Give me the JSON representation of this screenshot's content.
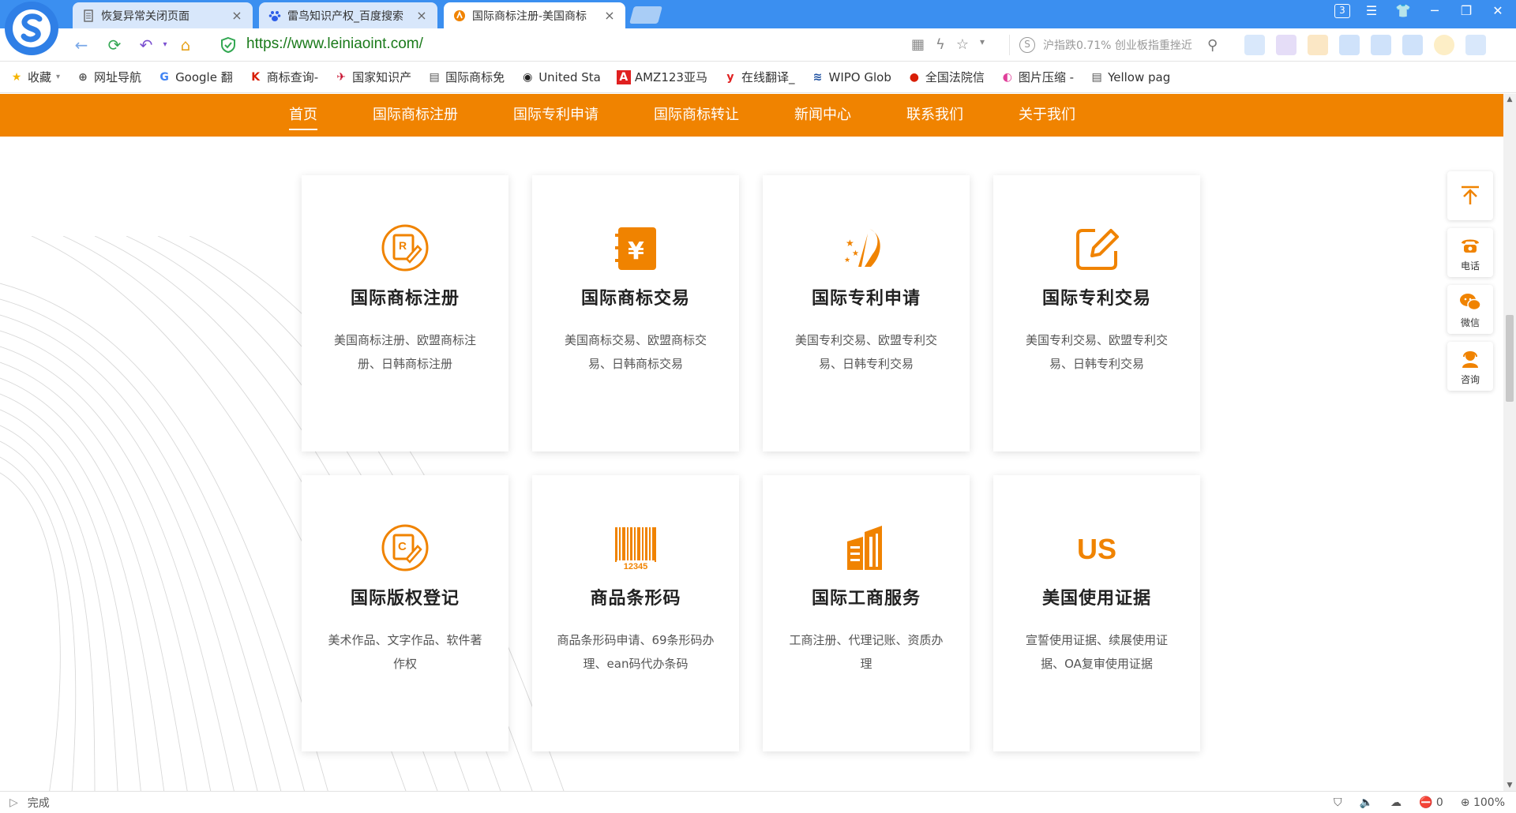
{
  "browser": {
    "tabs": [
      {
        "title": "恢复异常关闭页面",
        "icon": "page-icon"
      },
      {
        "title": "雷鸟知识产权_百度搜索",
        "icon": "baidu-paw-icon"
      },
      {
        "title": "国际商标注册-美国商标",
        "icon": "site-favicon-icon"
      }
    ],
    "window_badge": "3",
    "url": "https://www.leiniaoint.com/",
    "search_placeholder": "沪指跌0.71% 创业板指重挫近",
    "bookmarks": [
      {
        "label": "收藏",
        "icon": "star-icon"
      },
      {
        "label": "网址导航",
        "icon": "globe-icon"
      },
      {
        "label": "Google 翻",
        "icon": "google-translate-icon"
      },
      {
        "label": "商标查询-",
        "icon": "k-icon"
      },
      {
        "label": "国家知识产",
        "icon": "cnipa-icon"
      },
      {
        "label": "国际商标免",
        "icon": "page-icon"
      },
      {
        "label": "United Sta",
        "icon": "uspto-icon"
      },
      {
        "label": "AMZ123亚马",
        "icon": "amz-icon"
      },
      {
        "label": "在线翻译_",
        "icon": "y-icon"
      },
      {
        "label": "WIPO Glob",
        "icon": "wipo-icon"
      },
      {
        "label": "全国法院信",
        "icon": "court-icon"
      },
      {
        "label": "图片压缩 -",
        "icon": "image-compress-icon"
      },
      {
        "label": "Yellow pag",
        "icon": "page-icon"
      }
    ],
    "status_text": "完成",
    "status_count": "0",
    "zoom": "100%"
  },
  "site": {
    "nav": [
      "首页",
      "国际商标注册",
      "国际专利申请",
      "国际商标转让",
      "新闻中心",
      "联系我们",
      "关于我们"
    ],
    "nav_active": "首页",
    "accent": "#f08300",
    "cards": [
      {
        "title": "国际商标注册",
        "desc": "美国商标注册、欧盟商标注册、日韩商标注册",
        "icon": "trademark-r-icon"
      },
      {
        "title": "国际商标交易",
        "desc": "美国商标交易、欧盟商标交易、日韩商标交易",
        "icon": "yuan-notebook-icon"
      },
      {
        "title": "国际专利申请",
        "desc": "美国专利交易、欧盟专利交易、日韩专利交易",
        "icon": "road-stars-icon"
      },
      {
        "title": "国际专利交易",
        "desc": "美国专利交易、欧盟专利交易、日韩专利交易",
        "icon": "edit-pen-icon"
      },
      {
        "title": "国际版权登记",
        "desc": "美术作品、文字作品、软件著作权",
        "icon": "copyright-c-icon"
      },
      {
        "title": "商品条形码",
        "desc": "商品条形码申请、69条形码办理、ean码代办条码",
        "icon": "barcode-icon",
        "barcode_number": "12345"
      },
      {
        "title": "国际工商服务",
        "desc": "工商注册、代理记账、资质办理",
        "icon": "buildings-icon"
      },
      {
        "title": "美国使用证据",
        "desc": "宣誓使用证据、续展使用证据、OA复审使用证据",
        "icon": "us-text-icon",
        "icon_text": "US"
      }
    ],
    "float_bar": [
      {
        "label": "",
        "icon": "back-to-top-icon"
      },
      {
        "label": "电话",
        "icon": "phone-icon"
      },
      {
        "label": "微信",
        "icon": "wechat-icon"
      },
      {
        "label": "咨询",
        "icon": "consult-icon"
      }
    ]
  }
}
